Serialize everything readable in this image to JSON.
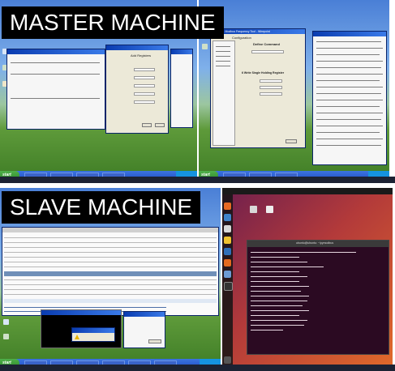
{
  "master": {
    "label": "MASTER MACHINE",
    "left_window": {
      "title": "Add Registers"
    },
    "right_window": {
      "title": "Modbus - Modbus Frequency Tool - Wirepoint",
      "menu_item": "Configuration",
      "define_command_title": "Define Command",
      "section_title": "6 Write Single Holding Register"
    },
    "taskbar": {
      "start_label": "start"
    }
  },
  "slave": {
    "label": "SLAVE MACHINE",
    "terminal": {
      "title": "ubuntu@ubuntu: ~/pymodbus"
    },
    "taskbar": {
      "start_label": "start"
    }
  },
  "colors": {
    "xp_taskbar": "#2350c8",
    "xp_start": "#2f8a2c",
    "ubuntu_bg": "#b33a3a",
    "terminal_bg": "#2b0a22",
    "terminal_text": "#f0e6ec",
    "label_bg": "#000000"
  }
}
